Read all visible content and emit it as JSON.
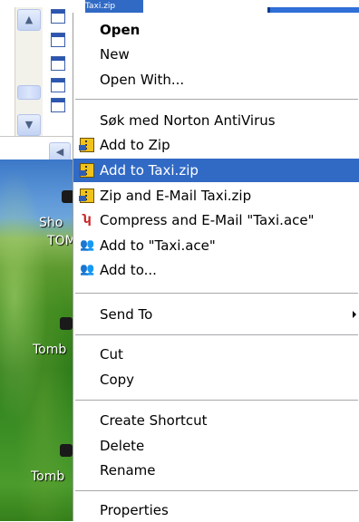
{
  "background": {
    "file_name": "Taxi.zip",
    "desktop_labels": [
      "Sho",
      "TOM",
      "Tomb",
      "Tomb"
    ]
  },
  "menu": {
    "open": "Open",
    "new": "New",
    "open_with": "Open With...",
    "norton_scan": "Søk med Norton AntiVirus",
    "add_to_zip": "Add to Zip",
    "add_to_taxi_zip": "Add to Taxi.zip",
    "zip_and_email": "Zip and E-Mail Taxi.zip",
    "compress_and_email": "Compress and E-Mail \"Taxi.ace\"",
    "add_to_taxi_ace": "Add to \"Taxi.ace\"",
    "add_to": "Add to...",
    "send_to": "Send To",
    "cut": "Cut",
    "copy": "Copy",
    "create_shortcut": "Create Shortcut",
    "delete": "Delete",
    "rename": "Rename",
    "properties": "Properties"
  },
  "icons": {
    "zip": "winzip-icon",
    "ace": "winace-icon",
    "people": "people-icon",
    "submenu": "chevron-right-icon"
  },
  "colors": {
    "highlight": "#316ac5",
    "menu_bg": "#ffffff",
    "separator": "#a7a6aa"
  }
}
